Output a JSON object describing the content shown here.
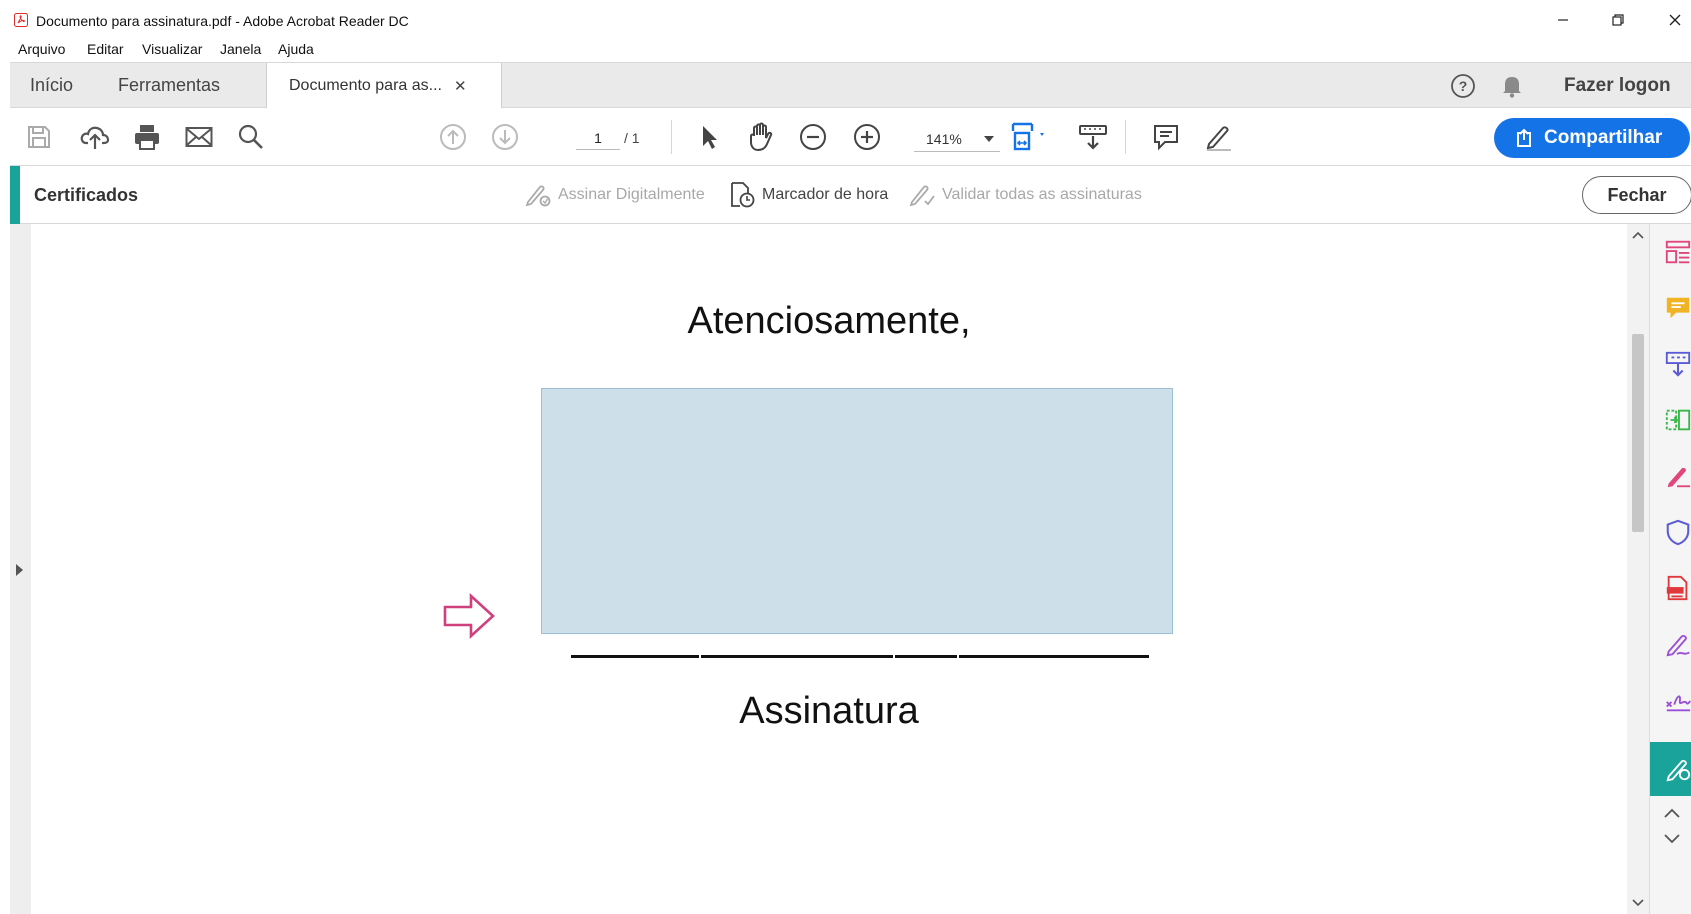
{
  "window": {
    "title": "Documento para assinatura.pdf - Adobe Acrobat Reader DC"
  },
  "menu": {
    "items": [
      "Arquivo",
      "Editar",
      "Visualizar",
      "Janela",
      "Ajuda"
    ]
  },
  "tabs": {
    "home": "Início",
    "tools": "Ferramentas",
    "document": "Documento para as...",
    "close_glyph": "✕"
  },
  "header_right": {
    "login": "Fazer logon"
  },
  "toolbar": {
    "current_page": "1",
    "total_pages": "/ 1",
    "zoom": "141%",
    "share_label": "Compartilhar"
  },
  "cert_bar": {
    "title": "Certificados",
    "sign_digitally": "Assinar Digitalmente",
    "timestamp": "Marcador de hora",
    "validate_all": "Validar todas as assinaturas",
    "close": "Fechar"
  },
  "document": {
    "closing": "Atenciosamente,",
    "signature_label": "Assinatura"
  },
  "colors": {
    "accent": "#1aa39a",
    "share_button": "#1473e6",
    "signature_field": "#cde0ea",
    "arrow": "#d0407e"
  },
  "right_rail_icons": [
    "organize-pages-icon",
    "comment-icon",
    "compress-pdf-icon",
    "combine-files-icon",
    "fill-sign-icon",
    "protect-icon",
    "export-pdf-icon",
    "request-signature-icon",
    "fill-form-icon",
    "edit-pdf-icon",
    "certificates-icon"
  ]
}
